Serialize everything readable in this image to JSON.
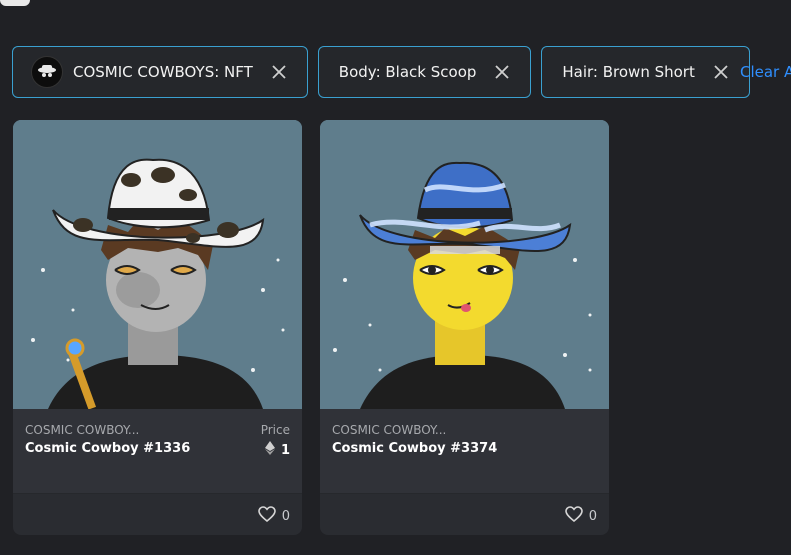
{
  "filters": [
    {
      "label": "COSMIC COWBOYS: NFT",
      "has_avatar": true
    },
    {
      "label": "Body: Black Scoop"
    },
    {
      "label": "Hair: Brown Short"
    }
  ],
  "clear_all_label": "Clear A",
  "cards": [
    {
      "collection": "COSMIC COWBOY...",
      "name": "Cosmic Cowboy #1336",
      "price_label": "Price",
      "price": "1",
      "likes": "0",
      "hat_style": "cow-print",
      "skin_color": "#a9a9a9"
    },
    {
      "collection": "COSMIC COWBOY...",
      "name": "Cosmic Cowboy #3374",
      "likes": "0",
      "hat_style": "blue-swirl",
      "skin_color": "#f3da2e"
    }
  ],
  "colors": {
    "accent_border": "#3aa0d0",
    "link_blue": "#2f8fff",
    "art_bg": "#5f7d8c"
  }
}
